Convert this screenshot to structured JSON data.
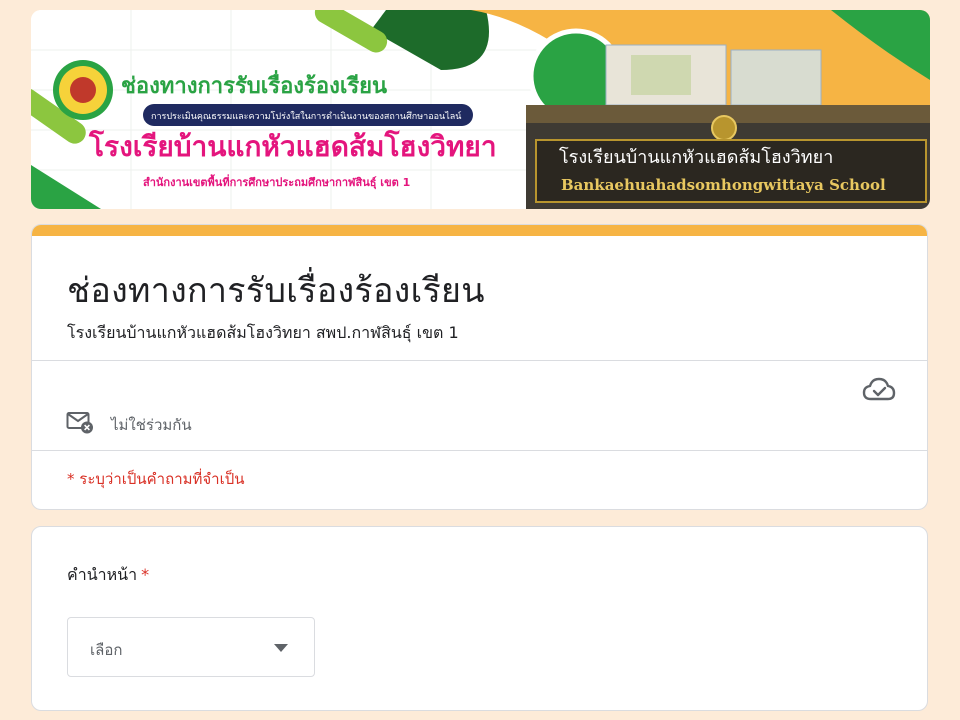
{
  "banner": {
    "channel_title": "ช่องทางการรับเรื่องร้องเรียน",
    "subtitle_pill": "การประเมินคุณธรรมและความโปร่งใสในการดำเนินงานของสถานศึกษาออนไลน์",
    "school_name": "โรงเรียบ้านแกหัวแฮดส้มโฮงวิทยา",
    "office": "สำนักงานเขตพื้นที่การศึกษาประถมศึกษากาฬสินธุ์ เขต 1",
    "sign_thai": "โรงเรียนบ้านแกหัวแฮดส้มโฮงวิทยา",
    "sign_english": "Bankaehuahadsomhongwittaya School",
    "colors": {
      "green": "#2aa344",
      "orange": "#f6b444",
      "lime": "#8cc63f",
      "pink": "#e4157d",
      "dark_green": "#1d6b2a"
    }
  },
  "form": {
    "title": "ช่องทางการรับเรื่องร้องเรียน",
    "description": "โรงเรียนบ้านแกหัวแฮดส้มโฮงวิทยา สพป.กาฬสินธุ์ เขต 1",
    "email_status": "ไม่ใช่ร่วมกัน",
    "required_note": "* ระบุว่าเป็นคำถามที่จำเป็น",
    "cloud_icon": "cloud-saved-icon",
    "mail_icon": "mail-not-shared-icon"
  },
  "question": {
    "label": "คำนำหน้า",
    "required_mark": "*",
    "select_placeholder": "เลือก"
  },
  "colors": {
    "accent": "#f6b444",
    "required": "#d93025",
    "page_bg": "#fdebd8"
  }
}
